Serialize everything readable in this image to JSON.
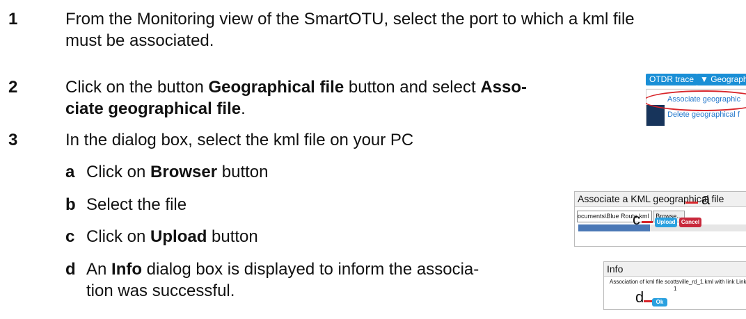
{
  "steps": {
    "s1": {
      "num": "1",
      "line1": "From the Monitoring view of the SmartOTU, select the port to which a kml file",
      "line2": "must be associated."
    },
    "s2": {
      "num": "2",
      "pre": "Click on the button ",
      "bold1": "Geographical file",
      "mid": " button and select ",
      "bold2a": "Asso-",
      "bold2b": "ciate geographical file",
      "end": "."
    },
    "s3": {
      "num": "3",
      "text": "In the dialog box, select the kml file on your PC"
    },
    "substeps": [
      {
        "letter": "a",
        "pre": "Click on ",
        "bold": "Browser",
        "post": " button"
      },
      {
        "letter": "b",
        "pre": "Select the file",
        "bold": "",
        "post": ""
      },
      {
        "letter": "c",
        "pre": "Click on ",
        "bold": "Upload",
        "post": " button"
      },
      {
        "letter": "d",
        "pre": "An ",
        "bold": "Info",
        "post": " dialog box is displayed to inform the associa-",
        "line2": "tion was successful."
      }
    ]
  },
  "shot1": {
    "btn1": "OTDR trace",
    "btn2": "▼ Geograph",
    "item1": "Associate geographic",
    "item2": "Delete geographical f",
    "accent": "#1a8fd6",
    "highlight": "#d8262b"
  },
  "shot2": {
    "title": "Associate a KML geographical file",
    "file_value": "ocuments\\Blue Route.kml",
    "browse": "Browse...",
    "upload": "Upload",
    "cancel": "Cancel",
    "progress": 0.42,
    "callout_a": "a",
    "callout_c": "c"
  },
  "shot3": {
    "title": "Info",
    "message": "Association of kml file scottsville_rd_1.kml with link Link",
    "message2": "1",
    "ok": "Ok",
    "callout_d": "d"
  }
}
